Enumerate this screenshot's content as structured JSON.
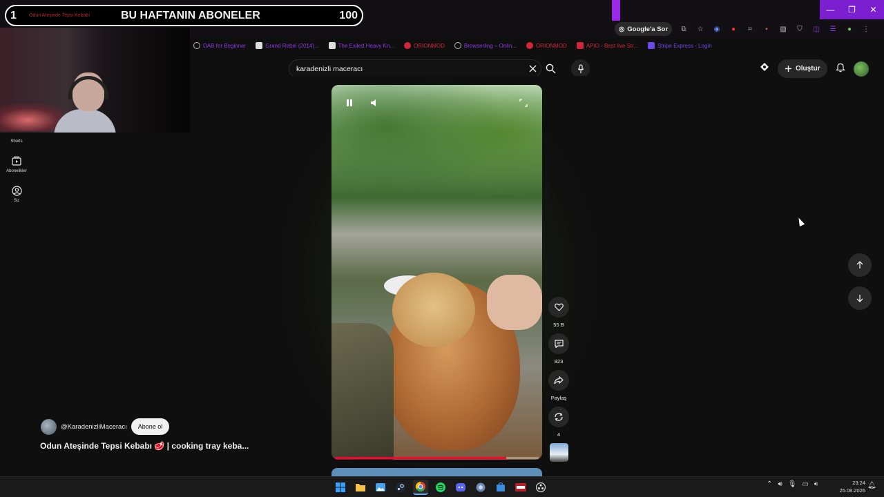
{
  "overlay": {
    "rank": "1",
    "title": "BU HAFTANIN ABONELER",
    "count": "100",
    "tab_text": "Odun Ateşinde Tepsi Kebabı"
  },
  "window_controls": {
    "minimize": "—",
    "restore": "❐",
    "close": "✕"
  },
  "toolbar": {
    "ask_google_label": "Google'a Sor"
  },
  "bookmarks": [
    {
      "label": "DAB for Beginner",
      "color": "#8a38e6"
    },
    {
      "label": "Grand Rebel (2014)...",
      "color": "#8a38e6"
    },
    {
      "label": "The Exiled Heavy Kn...",
      "color": "#8a38e6"
    },
    {
      "label": "ORIONMOD",
      "color": "#d0263a"
    },
    {
      "label": "Browserling – Onlin...",
      "color": "#8a38e6"
    },
    {
      "label": "ORIONMOD",
      "color": "#d0263a"
    },
    {
      "label": "APIO - Best live Str...",
      "color": "#d0263a"
    },
    {
      "label": "Stripe Express - Login",
      "color": "#6b49e6"
    }
  ],
  "sidebar": {
    "items": [
      {
        "label": "Shorts"
      },
      {
        "label": "Abonelikler"
      },
      {
        "label": "Siz"
      }
    ]
  },
  "search": {
    "query": "karadenizli maceracı"
  },
  "header": {
    "create_label": "Oluştur"
  },
  "short": {
    "progress_fraction": 0.84,
    "actions": {
      "likes": "55 B",
      "comments": "823",
      "share_label": "Paylaş",
      "remix_count": "4"
    },
    "channel": "@KaradenizliMaceracı",
    "subscribe_label": "Abone ol",
    "title": "Odun Ateşinde Tepsi Kebabı 🥩 | cooking tray keba..."
  },
  "taskbar": {
    "time": "23:24",
    "date": "25.08.2026"
  }
}
